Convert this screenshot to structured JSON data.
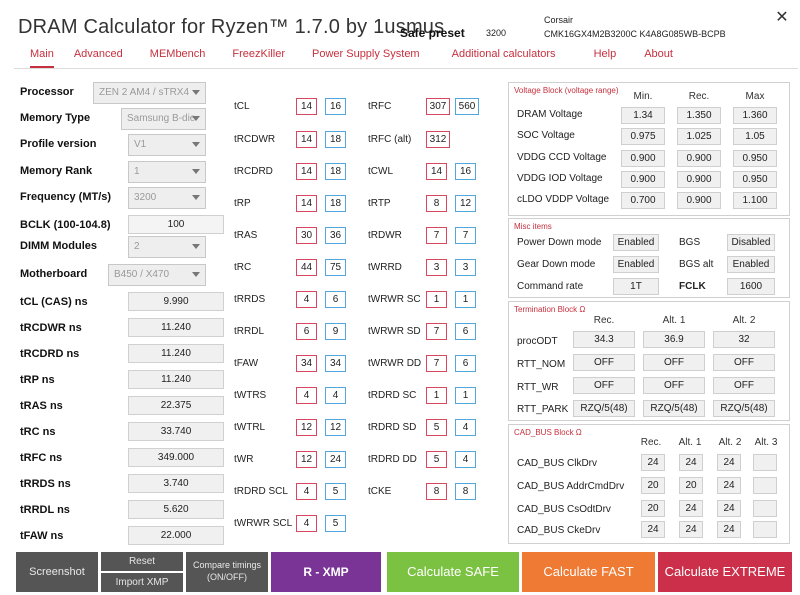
{
  "header": {
    "title": "DRAM Calculator for Ryzen™ 1.7.0 by 1usmus",
    "safe_preset_label": "Safe preset",
    "safe_preset_value": "3200",
    "manufacturer": "Corsair",
    "part_number": "CMK16GX4M2B3200C K4A8G085WB-BCPB",
    "close": "✕"
  },
  "menu": [
    "Main",
    "Advanced",
    "MEMbench",
    "FreezKiller",
    "Power Supply System",
    "Additional calculators",
    "Help",
    "About"
  ],
  "left": {
    "processor_label": "Processor",
    "processor_value": "ZEN 2 AM4 / sTRX4",
    "memtype_label": "Memory Type",
    "memtype_value": "Samsung B-die",
    "profile_label": "Profile version",
    "profile_value": "V1",
    "rank_label": "Memory Rank",
    "rank_value": "1",
    "freq_label": "Frequency (MT/s)",
    "freq_value": "3200",
    "bclk_label": "BCLK (100-104.8)",
    "bclk_value": "100",
    "dimm_label": "DIMM Modules",
    "dimm_value": "2",
    "mobo_label": "Motherboard",
    "mobo_value": "B450 / X470",
    "ns": [
      {
        "label": "tCL (CAS) ns",
        "value": "9.990"
      },
      {
        "label": "tRCDWR ns",
        "value": "11.240"
      },
      {
        "label": "tRCDRD ns",
        "value": "11.240"
      },
      {
        "label": "tRP ns",
        "value": "11.240"
      },
      {
        "label": "tRAS ns",
        "value": "22.375"
      },
      {
        "label": "tRC ns",
        "value": "33.740"
      },
      {
        "label": "tRFC ns",
        "value": "349.000"
      },
      {
        "label": "tRRDS ns",
        "value": "3.740"
      },
      {
        "label": "tRRDL ns",
        "value": "5.620"
      },
      {
        "label": "tFAW ns",
        "value": "22.000"
      }
    ]
  },
  "timings_col1": [
    {
      "label": "tCL",
      "a": "14",
      "b": "16"
    },
    {
      "label": "tRCDWR",
      "a": "14",
      "b": "18"
    },
    {
      "label": "tRCDRD",
      "a": "14",
      "b": "18"
    },
    {
      "label": "tRP",
      "a": "14",
      "b": "18"
    },
    {
      "label": "tRAS",
      "a": "30",
      "b": "36"
    },
    {
      "label": "tRC",
      "a": "44",
      "b": "75"
    },
    {
      "label": "tRRDS",
      "a": "4",
      "b": "6"
    },
    {
      "label": "tRRDL",
      "a": "6",
      "b": "9"
    },
    {
      "label": "tFAW",
      "a": "34",
      "b": "34"
    },
    {
      "label": "tWTRS",
      "a": "4",
      "b": "4"
    },
    {
      "label": "tWTRL",
      "a": "12",
      "b": "12"
    },
    {
      "label": "tWR",
      "a": "12",
      "b": "24"
    },
    {
      "label": "tRDRD SCL",
      "a": "4",
      "b": "5"
    },
    {
      "label": "tWRWR SCL",
      "a": "4",
      "b": "5"
    }
  ],
  "timings_col2": [
    {
      "label": "tRFC",
      "a": "307",
      "b": "560"
    },
    {
      "label": "tRFC (alt)",
      "a": "312",
      "b": ""
    },
    {
      "label": "tCWL",
      "a": "14",
      "b": "16"
    },
    {
      "label": "tRTP",
      "a": "8",
      "b": "12"
    },
    {
      "label": "tRDWR",
      "a": "7",
      "b": "7"
    },
    {
      "label": "tWRRD",
      "a": "3",
      "b": "3"
    },
    {
      "label": "tWRWR SC",
      "a": "1",
      "b": "1"
    },
    {
      "label": "tWRWR SD",
      "a": "7",
      "b": "6"
    },
    {
      "label": "tWRWR DD",
      "a": "7",
      "b": "6"
    },
    {
      "label": "tRDRD SC",
      "a": "1",
      "b": "1"
    },
    {
      "label": "tRDRD SD",
      "a": "5",
      "b": "4"
    },
    {
      "label": "tRDRD DD",
      "a": "5",
      "b": "4"
    },
    {
      "label": "tCKE",
      "a": "8",
      "b": "8"
    }
  ],
  "voltage": {
    "title": "Voltage Block (voltage range)",
    "heads": [
      "Min.",
      "Rec.",
      "Max"
    ],
    "rows": [
      {
        "label": "DRAM Voltage",
        "min": "1.34",
        "rec": "1.350",
        "max": "1.360"
      },
      {
        "label": "SOC Voltage",
        "min": "0.975",
        "rec": "1.025",
        "max": "1.05"
      },
      {
        "label": "VDDG  CCD Voltage",
        "min": "0.900",
        "rec": "0.900",
        "max": "0.950"
      },
      {
        "label": "VDDG  IOD Voltage",
        "min": "0.900",
        "rec": "0.900",
        "max": "0.950"
      },
      {
        "label": "cLDO VDDP Voltage",
        "min": "0.700",
        "rec": "0.900",
        "max": "1.100"
      }
    ]
  },
  "misc": {
    "title": "Misc items",
    "pdm_label": "Power Down mode",
    "pdm_value": "Enabled",
    "bgs_label": "BGS",
    "bgs_value": "Disabled",
    "gdm_label": "Gear Down mode",
    "gdm_value": "Enabled",
    "bgsalt_label": "BGS alt",
    "bgsalt_value": "Enabled",
    "cr_label": "Command rate",
    "cr_value": "1T",
    "fclk_label": "FCLK",
    "fclk_value": "1600"
  },
  "termination": {
    "title": "Termination Block Ω",
    "heads": [
      "Rec.",
      "Alt. 1",
      "Alt. 2"
    ],
    "rows": [
      {
        "label": "procODT",
        "v": [
          "34.3",
          "36.9",
          "32"
        ]
      },
      {
        "label": "RTT_NOM",
        "v": [
          "OFF",
          "OFF",
          "OFF"
        ]
      },
      {
        "label": "RTT_WR",
        "v": [
          "OFF",
          "OFF",
          "OFF"
        ]
      },
      {
        "label": "RTT_PARK",
        "v": [
          "RZQ/5(48)",
          "RZQ/5(48)",
          "RZQ/5(48)"
        ]
      }
    ]
  },
  "cadbus": {
    "title": "CAD_BUS Block Ω",
    "heads": [
      "Rec.",
      "Alt. 1",
      "Alt. 2",
      "Alt. 3"
    ],
    "rows": [
      {
        "label": "CAD_BUS ClkDrv",
        "v": [
          "24",
          "24",
          "24",
          ""
        ]
      },
      {
        "label": "CAD_BUS AddrCmdDrv",
        "v": [
          "20",
          "20",
          "24",
          ""
        ]
      },
      {
        "label": "CAD_BUS CsOdtDrv",
        "v": [
          "20",
          "24",
          "24",
          ""
        ]
      },
      {
        "label": "CAD_BUS CkeDrv",
        "v": [
          "24",
          "24",
          "24",
          ""
        ]
      }
    ]
  },
  "bottom": {
    "screenshot": "Screenshot",
    "reset": "Reset",
    "import_xmp": "Import XMP",
    "compare": "Compare timings (ON/OFF)",
    "rxmp": "R - XMP",
    "safe": "Calculate SAFE",
    "fast": "Calculate FAST",
    "extreme": "Calculate EXTREME"
  },
  "colors": {
    "accent": "#c6303e",
    "rxmp": "#7a3496",
    "safe": "#7cc242",
    "fast": "#ee7a34",
    "extreme": "#cc2f4a",
    "dark_button": "#555555"
  }
}
